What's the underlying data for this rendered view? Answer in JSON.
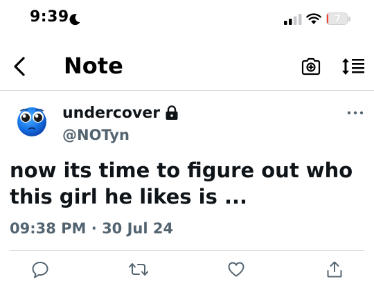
{
  "status_bar": {
    "time": "9:39",
    "battery_level": "7",
    "battery_fraction": 0.07,
    "icons": [
      "moon-icon",
      "cellular-signal-icon",
      "wifi-icon",
      "battery-icon"
    ]
  },
  "header": {
    "title": "Note",
    "icons": [
      "back-chevron-icon",
      "camera-icon",
      "sort-order-icon"
    ]
  },
  "post": {
    "display_name": "undercover",
    "username": "@NOTyn",
    "text": "now its time to figure out who this girl he likes is ...",
    "time": "09:38 PM",
    "separator": "·",
    "date": "30 Jul 24",
    "icons": [
      "avatar-emoji-icon",
      "lock-icon",
      "more-options-icon"
    ]
  },
  "actions": {
    "icons": [
      "reply-icon",
      "repost-icon",
      "like-icon",
      "share-icon"
    ]
  },
  "colors": {
    "text": "#0f1419",
    "secondary": "#536471",
    "divider": "#cfd9de",
    "battery_low": "#ff3b30"
  }
}
